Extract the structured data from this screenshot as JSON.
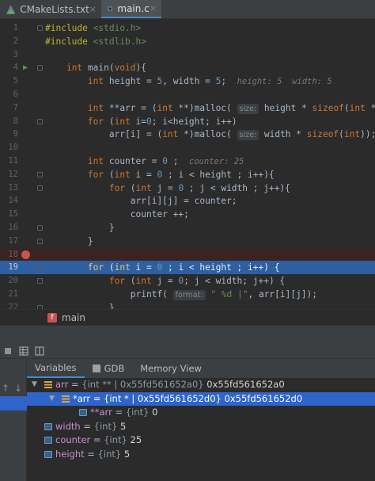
{
  "tabs": [
    {
      "label": "CMakeLists.txt",
      "active": false
    },
    {
      "label": "main.c",
      "active": true
    }
  ],
  "tab_close": "×",
  "code_lines": [
    {
      "n": "1",
      "html": "<span class=\"mac\">#include</span> <span class=\"inc\">&lt;stdio.h&gt;</span>"
    },
    {
      "n": "2",
      "html": "<span class=\"mac\">#include</span> <span class=\"inc\">&lt;stdlib.h&gt;</span>"
    },
    {
      "n": "3",
      "html": ""
    },
    {
      "n": "4",
      "html": "    <span class=\"kw\">int</span> main(<span class=\"kw\">void</span>){"
    },
    {
      "n": "5",
      "html": "        <span class=\"kw\">int</span> height = <span class=\"num\">5</span>, width = <span class=\"num\">5</span>;  <span class=\"hint\">height: 5  width: 5</span>"
    },
    {
      "n": "6",
      "html": ""
    },
    {
      "n": "7",
      "html": "        <span class=\"kw\">int</span> **arr = (<span class=\"kw\">int</span> **)malloc( <span class=\"pname\">size:</span> height * <span class=\"kw\">sizeof</span>(<span class=\"kw\">int</span> *));"
    },
    {
      "n": "8",
      "html": "        <span class=\"kw\">for</span> (<span class=\"kw\">int</span> i=<span class=\"num\">0</span>; i&lt;height; i++)"
    },
    {
      "n": "9",
      "html": "            arr[i] = (<span class=\"kw\">int</span> *)malloc( <span class=\"pname\">size:</span> width * <span class=\"kw\">sizeof</span>(<span class=\"kw\">int</span>));"
    },
    {
      "n": "10",
      "html": ""
    },
    {
      "n": "11",
      "html": "        <span class=\"kw\">int</span> counter = <span class=\"num\">0</span> ;  <span class=\"hint\">counter: 25</span>"
    },
    {
      "n": "12",
      "html": "        <span class=\"kw\">for</span> (<span class=\"kw\">int</span> i = <span class=\"num\">0</span> ; i &lt; height ; i++){"
    },
    {
      "n": "13",
      "html": "            <span class=\"kw\">for</span> (<span class=\"kw\">int</span> j = <span class=\"num\">0</span> ; j &lt; width ; j++){"
    },
    {
      "n": "14",
      "html": "                arr[i][j] = counter;"
    },
    {
      "n": "15",
      "html": "                counter ++;"
    },
    {
      "n": "16",
      "html": "            }"
    },
    {
      "n": "17",
      "html": "        }"
    },
    {
      "n": "18",
      "html": ""
    },
    {
      "n": "19",
      "html": "        <span class=\"kw\">for</span> (<span class=\"kw\">int</span> i = <span class=\"num\">0</span> ; i &lt; height ; i++) {"
    },
    {
      "n": "20",
      "html": "            <span class=\"kw\">for</span> (<span class=\"kw\">int</span> j = <span class=\"num\">0</span>; j &lt; width; j++) {"
    },
    {
      "n": "21",
      "html": "                printf( <span class=\"pname\">format:</span> <span class=\"str\">\" %d |\"</span>, arr[i][j]);"
    },
    {
      "n": "22",
      "html": "            }"
    }
  ],
  "breakpoint_line": "18",
  "exec_line": "19",
  "breadcrumb": {
    "badge": "f",
    "function": "main"
  },
  "debug_tabs": [
    {
      "label": "Variables",
      "active": true
    },
    {
      "label": "GDB",
      "active": false
    },
    {
      "label": "Memory View",
      "active": false
    }
  ],
  "variables": [
    {
      "name": "arr",
      "type": "{int ** | 0x55fd561652a0}",
      "value": "0x55fd561652a0",
      "indent": 0,
      "expanded": true,
      "icon": "array",
      "selected": false
    },
    {
      "name": "*arr",
      "type": "{int * | 0x55fd561652d0}",
      "value": "0x55fd561652d0",
      "indent": 1,
      "expanded": true,
      "icon": "array",
      "selected": true
    },
    {
      "name": "**arr",
      "type": "{int}",
      "value": "0",
      "indent": 2,
      "expanded": null,
      "icon": "primitive",
      "selected": false
    },
    {
      "name": "width",
      "type": "{int}",
      "value": "5",
      "indent": 0,
      "expanded": null,
      "icon": "primitive",
      "selected": false
    },
    {
      "name": "counter",
      "type": "{int}",
      "value": "25",
      "indent": 0,
      "expanded": null,
      "icon": "primitive",
      "selected": false
    },
    {
      "name": "height",
      "type": "{int}",
      "value": "5",
      "indent": 0,
      "expanded": null,
      "icon": "primitive",
      "selected": false
    }
  ],
  "colors": {
    "accent": "#4a88c7",
    "selection": "#2f65ca",
    "exec_line": "#2d5fa1",
    "breakpoint": "#c75450"
  }
}
